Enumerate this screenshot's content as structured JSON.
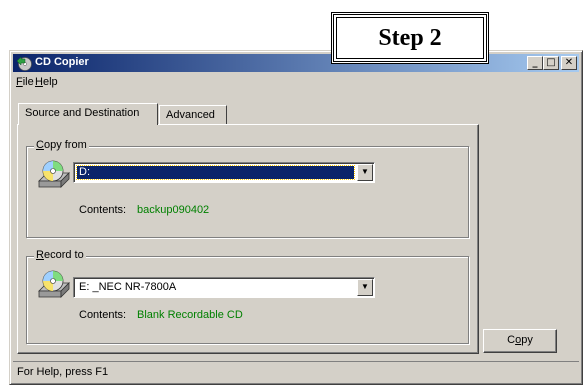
{
  "window": {
    "title": "CD Copier",
    "controls": {
      "minimize": "_",
      "maximize": "□",
      "close": "✕"
    }
  },
  "menu": [
    {
      "label_ul": "F",
      "label_rest": "ile"
    },
    {
      "label_ul": "H",
      "label_rest": "elp"
    }
  ],
  "tabs": [
    {
      "label": "Source and Destination",
      "active": true
    },
    {
      "label": "Advanced",
      "active": false
    }
  ],
  "copy_from": {
    "label_ul": "C",
    "label_rest": "opy from",
    "drive": "D:",
    "contents_label": "Contents:",
    "contents_value": "backup090402"
  },
  "record_to": {
    "label_ul": "R",
    "label_rest": "ecord to",
    "drive": "E: _NEC NR-7800A",
    "contents_label": "Contents:",
    "contents_value": "Blank Recordable CD"
  },
  "copy_button": {
    "label_pre": "C",
    "label_ul": "o",
    "label_post": "py"
  },
  "status": "For Help, press F1",
  "callout": "Step 2",
  "colors": {
    "title_start": "#0a246a",
    "title_end": "#a6caf0",
    "contents_text": "#008000",
    "window_bg": "#d4d0c8"
  },
  "icons": [
    "cd-copier-app-icon",
    "cd-drive-icon"
  ]
}
